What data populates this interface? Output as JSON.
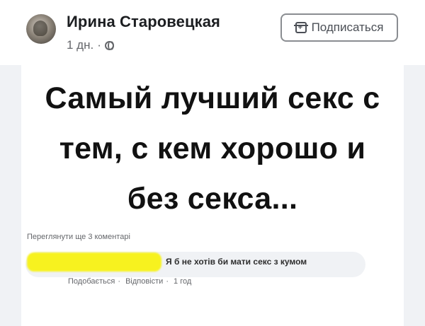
{
  "post": {
    "author": "Ирина Старовецкая",
    "time": "1 дн.",
    "separator": "·",
    "privacy_icon": "globe-icon",
    "subscribe_label": "Подписаться",
    "subscribe_icon": "add-follow-icon"
  },
  "image": {
    "headline": "Самый лучший секс с\nтем, с кем хорошо и\nбез секса...",
    "more_comments": "Переглянути ще 3 коментарі",
    "comment_text": "Я б не хотів би мати секс з кумом",
    "comment_actions": {
      "like": "Подобається",
      "dot1": "·",
      "reply": "Відповісти",
      "dot2": "·",
      "time": "1 год"
    },
    "highlight_color": "#f7f21f"
  }
}
